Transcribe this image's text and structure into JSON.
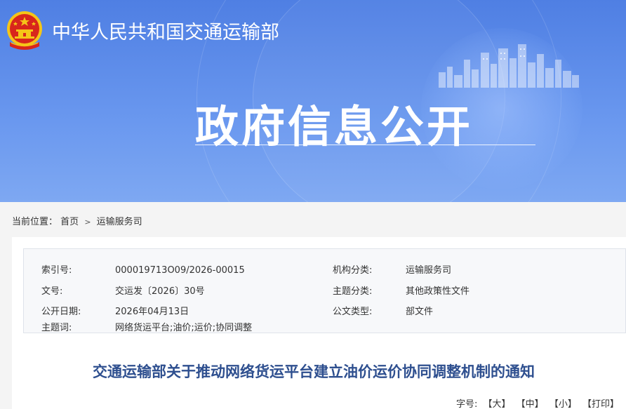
{
  "header": {
    "ministry_name": "中华人民共和国交通运输部",
    "hero_title": "政府信息公开"
  },
  "breadcrumb": {
    "label": "当前位置：",
    "items": [
      "首页",
      "运输服务司"
    ],
    "separator": ">"
  },
  "meta": {
    "rows": [
      {
        "k1": "索引号:",
        "v1": "000019713O09/2026-00015",
        "k2": "机构分类:",
        "v2": "运输服务司"
      },
      {
        "k1": "文号:",
        "v1": "交运发〔2026〕30号",
        "k2": "主题分类:",
        "v2": "其他政策性文件"
      },
      {
        "k1": "公开日期:",
        "v1": "2026年04月13日",
        "k2": "公文类型:",
        "v2": "部文件"
      },
      {
        "k1": "主题词:",
        "v1": "网络货运平台;油价;运价;协同调整",
        "k2": "",
        "v2": ""
      }
    ]
  },
  "document": {
    "title": "交通运输部关于推动网络货运平台建立油价运价协同调整机制的通知"
  },
  "font_controls": {
    "label": "字号:",
    "large": "【大】",
    "medium": "【中】",
    "small": "【小】",
    "print": "【打印】"
  },
  "colors": {
    "banner": "#5b8ae8",
    "title": "#2e4f8f",
    "emblem_red": "#d8261c",
    "emblem_gold": "#f5c518"
  },
  "icons": {
    "emblem": "national-emblem-icon",
    "skyline": "city-skyline-illustration"
  }
}
